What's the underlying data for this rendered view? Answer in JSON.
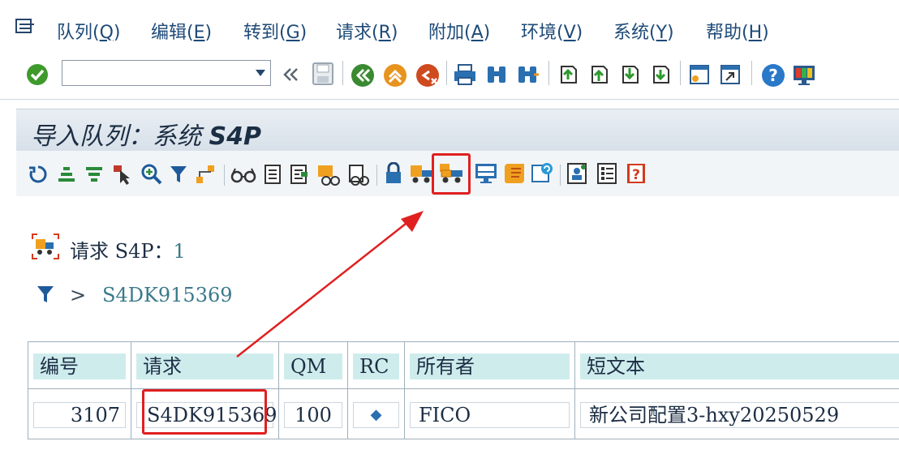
{
  "menu": {
    "items": [
      {
        "text": "队列(",
        "key": "Q",
        "close": ")"
      },
      {
        "text": "编辑(",
        "key": "E",
        "close": ")"
      },
      {
        "text": "转到(",
        "key": "G",
        "close": ")"
      },
      {
        "text": "请求(",
        "key": "R",
        "close": ")"
      },
      {
        "text": "附加(",
        "key": "A",
        "close": ")"
      },
      {
        "text": "环境(",
        "key": "V",
        "close": ")"
      },
      {
        "text": "系统(",
        "key": "Y",
        "close": ")"
      },
      {
        "text": "帮助(",
        "key": "H",
        "close": ")"
      }
    ]
  },
  "command_field": {
    "value": ""
  },
  "title": {
    "prefix": "导入队列：系统 ",
    "system": "S4P"
  },
  "request_label": {
    "label": "请求 S4P：",
    "count": "1"
  },
  "filter": {
    "arrow": ">",
    "value": "S4DK915369"
  },
  "table": {
    "headers": [
      "编号",
      "请求",
      "QM",
      "RC",
      "所有者",
      "短文本"
    ],
    "rows": [
      {
        "num": "3107",
        "request": "S4DK915369",
        "qm": "100",
        "rc": "◆",
        "owner": "FICO",
        "text": "新公司配置3-hxy20250529"
      }
    ]
  },
  "colors": {
    "highlight": "#e02020",
    "header_cell": "#cfeced",
    "link": "#3a7a8a"
  }
}
